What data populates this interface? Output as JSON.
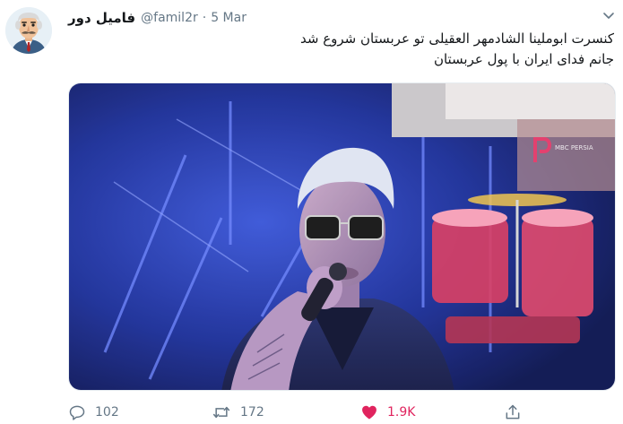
{
  "tweet": {
    "author": {
      "display_name": "فامیل دور",
      "handle": "@famil2r"
    },
    "separator": "·",
    "timestamp": "5 Mar",
    "text_lines": [
      "کنسرت ابوملینا الشادمهر العقیلی تو عربستان شروع شد",
      "جانم فدای ایران با پول عربستان"
    ],
    "media": {
      "watermark_text": "MBC PERSIA"
    },
    "actions": {
      "reply_count": "102",
      "retweet_count": "172",
      "like_count": "1.9K",
      "like_color": "#e0245e"
    }
  }
}
